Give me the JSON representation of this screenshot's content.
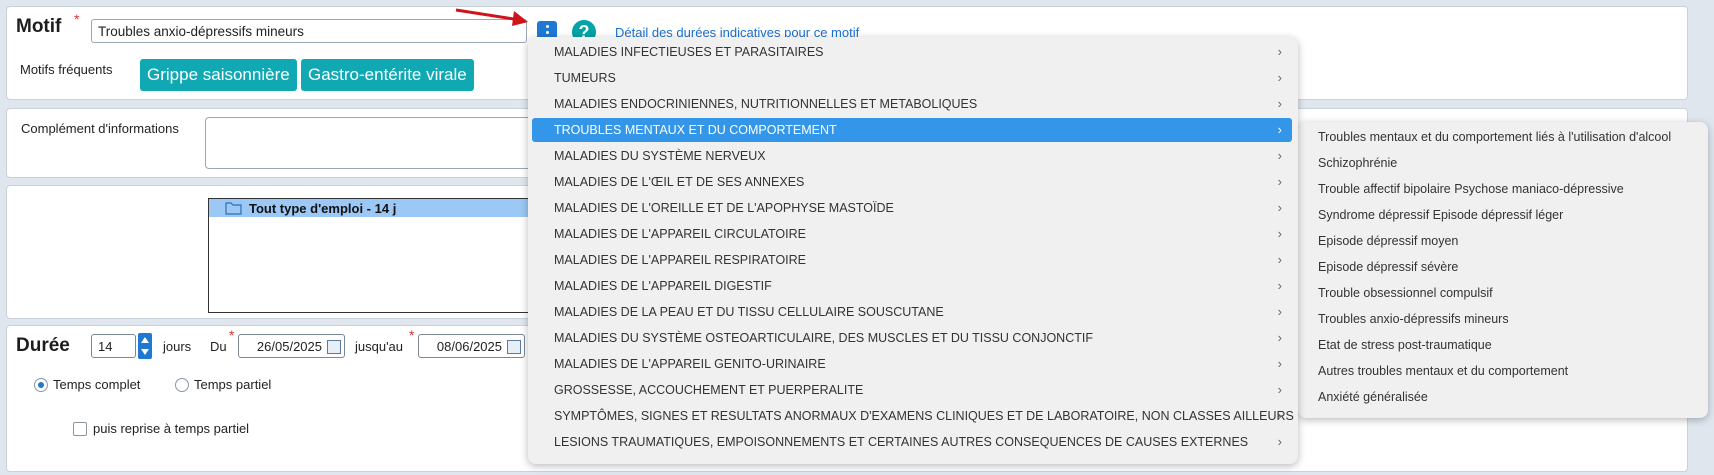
{
  "motif": {
    "title": "Motif",
    "required_mark": "*",
    "value": "Troubles anxio-dépressifs mineurs",
    "detail_link": "Détail des durées indicatives pour ce motif",
    "help_glyph": "?",
    "frequent_label": "Motifs fréquents",
    "frequent": [
      "Grippe saisonnière",
      "Gastro-entérite virale"
    ]
  },
  "complement": {
    "label": "Complément d'informations"
  },
  "tree": {
    "item_label": "Tout type d'emploi - 14 j"
  },
  "duree": {
    "title": "Durée",
    "days_value": "14",
    "days_label": "jours",
    "from_label": "Du",
    "from_date": "26/05/2025",
    "to_label": "jusqu'au",
    "to_date": "08/06/2025",
    "required_mark": "*",
    "radio_full": "Temps complet",
    "radio_partial": "Temps partiel",
    "checkbox_resume": "puis reprise à temps partiel"
  },
  "category_menu": {
    "selected_index": 3,
    "items": [
      "MALADIES INFECTIEUSES ET PARASITAIRES",
      "TUMEURS",
      "MALADIES ENDOCRINIENNES, NUTRITIONNELLES ET METABOLIQUES",
      "TROUBLES MENTAUX ET DU COMPORTEMENT",
      "MALADIES DU SYSTÈME NERVEUX",
      "MALADIES DE L'ŒIL ET DE SES ANNEXES",
      "MALADIES DE L'OREILLE ET DE L'APOPHYSE MASTOÏDE",
      "MALADIES DE L'APPAREIL CIRCULATOIRE",
      "MALADIES DE L'APPAREIL RESPIRATOIRE",
      "MALADIES DE L'APPAREIL DIGESTIF",
      "MALADIES DE LA PEAU ET DU TISSU CELLULAIRE SOUSCUTANE",
      "MALADIES DU SYSTÈME OSTEOARTICULAIRE, DES MUSCLES ET DU TISSU CONJONCTIF",
      "MALADIES DE L'APPAREIL GENITO-URINAIRE",
      "GROSSESSE, ACCOUCHEMENT ET PUERPERALITE",
      "SYMPTÔMES, SIGNES ET RESULTATS ANORMAUX D'EXAMENS CLINIQUES ET DE LABORATOIRE, NON CLASSES AILLEURS",
      "LESIONS TRAUMATIQUES, EMPOISONNEMENTS ET CERTAINES AUTRES CONSEQUENCES DE CAUSES EXTERNES"
    ]
  },
  "sub_menu": {
    "items": [
      "Troubles mentaux et du comportement liés à l'utilisation d'alcool",
      "Schizophrénie",
      "Trouble affectif bipolaire Psychose maniaco-dépressive",
      "Syndrome dépressif Episode dépressif léger",
      "Episode dépressif moyen",
      "Episode dépressif sévère",
      "Trouble obsessionnel compulsif",
      "Troubles anxio-dépressifs mineurs",
      "Etat de stress post-traumatique",
      "Autres troubles mentaux et du comportement",
      "Anxiété généralisée"
    ]
  },
  "icons": {
    "menu_button": "kebab-icon",
    "help": "help-icon",
    "chevron": "chevron-right-icon",
    "folder": "folder-icon",
    "calendar": "calendar-icon",
    "annotation": "red-arrow-icon"
  },
  "colors": {
    "accent": "#1f78d1",
    "chip": "#10a9b3",
    "menu_selected": "#3496e8",
    "tree_selected": "#9cc8f5",
    "help": "#00a3a6"
  }
}
